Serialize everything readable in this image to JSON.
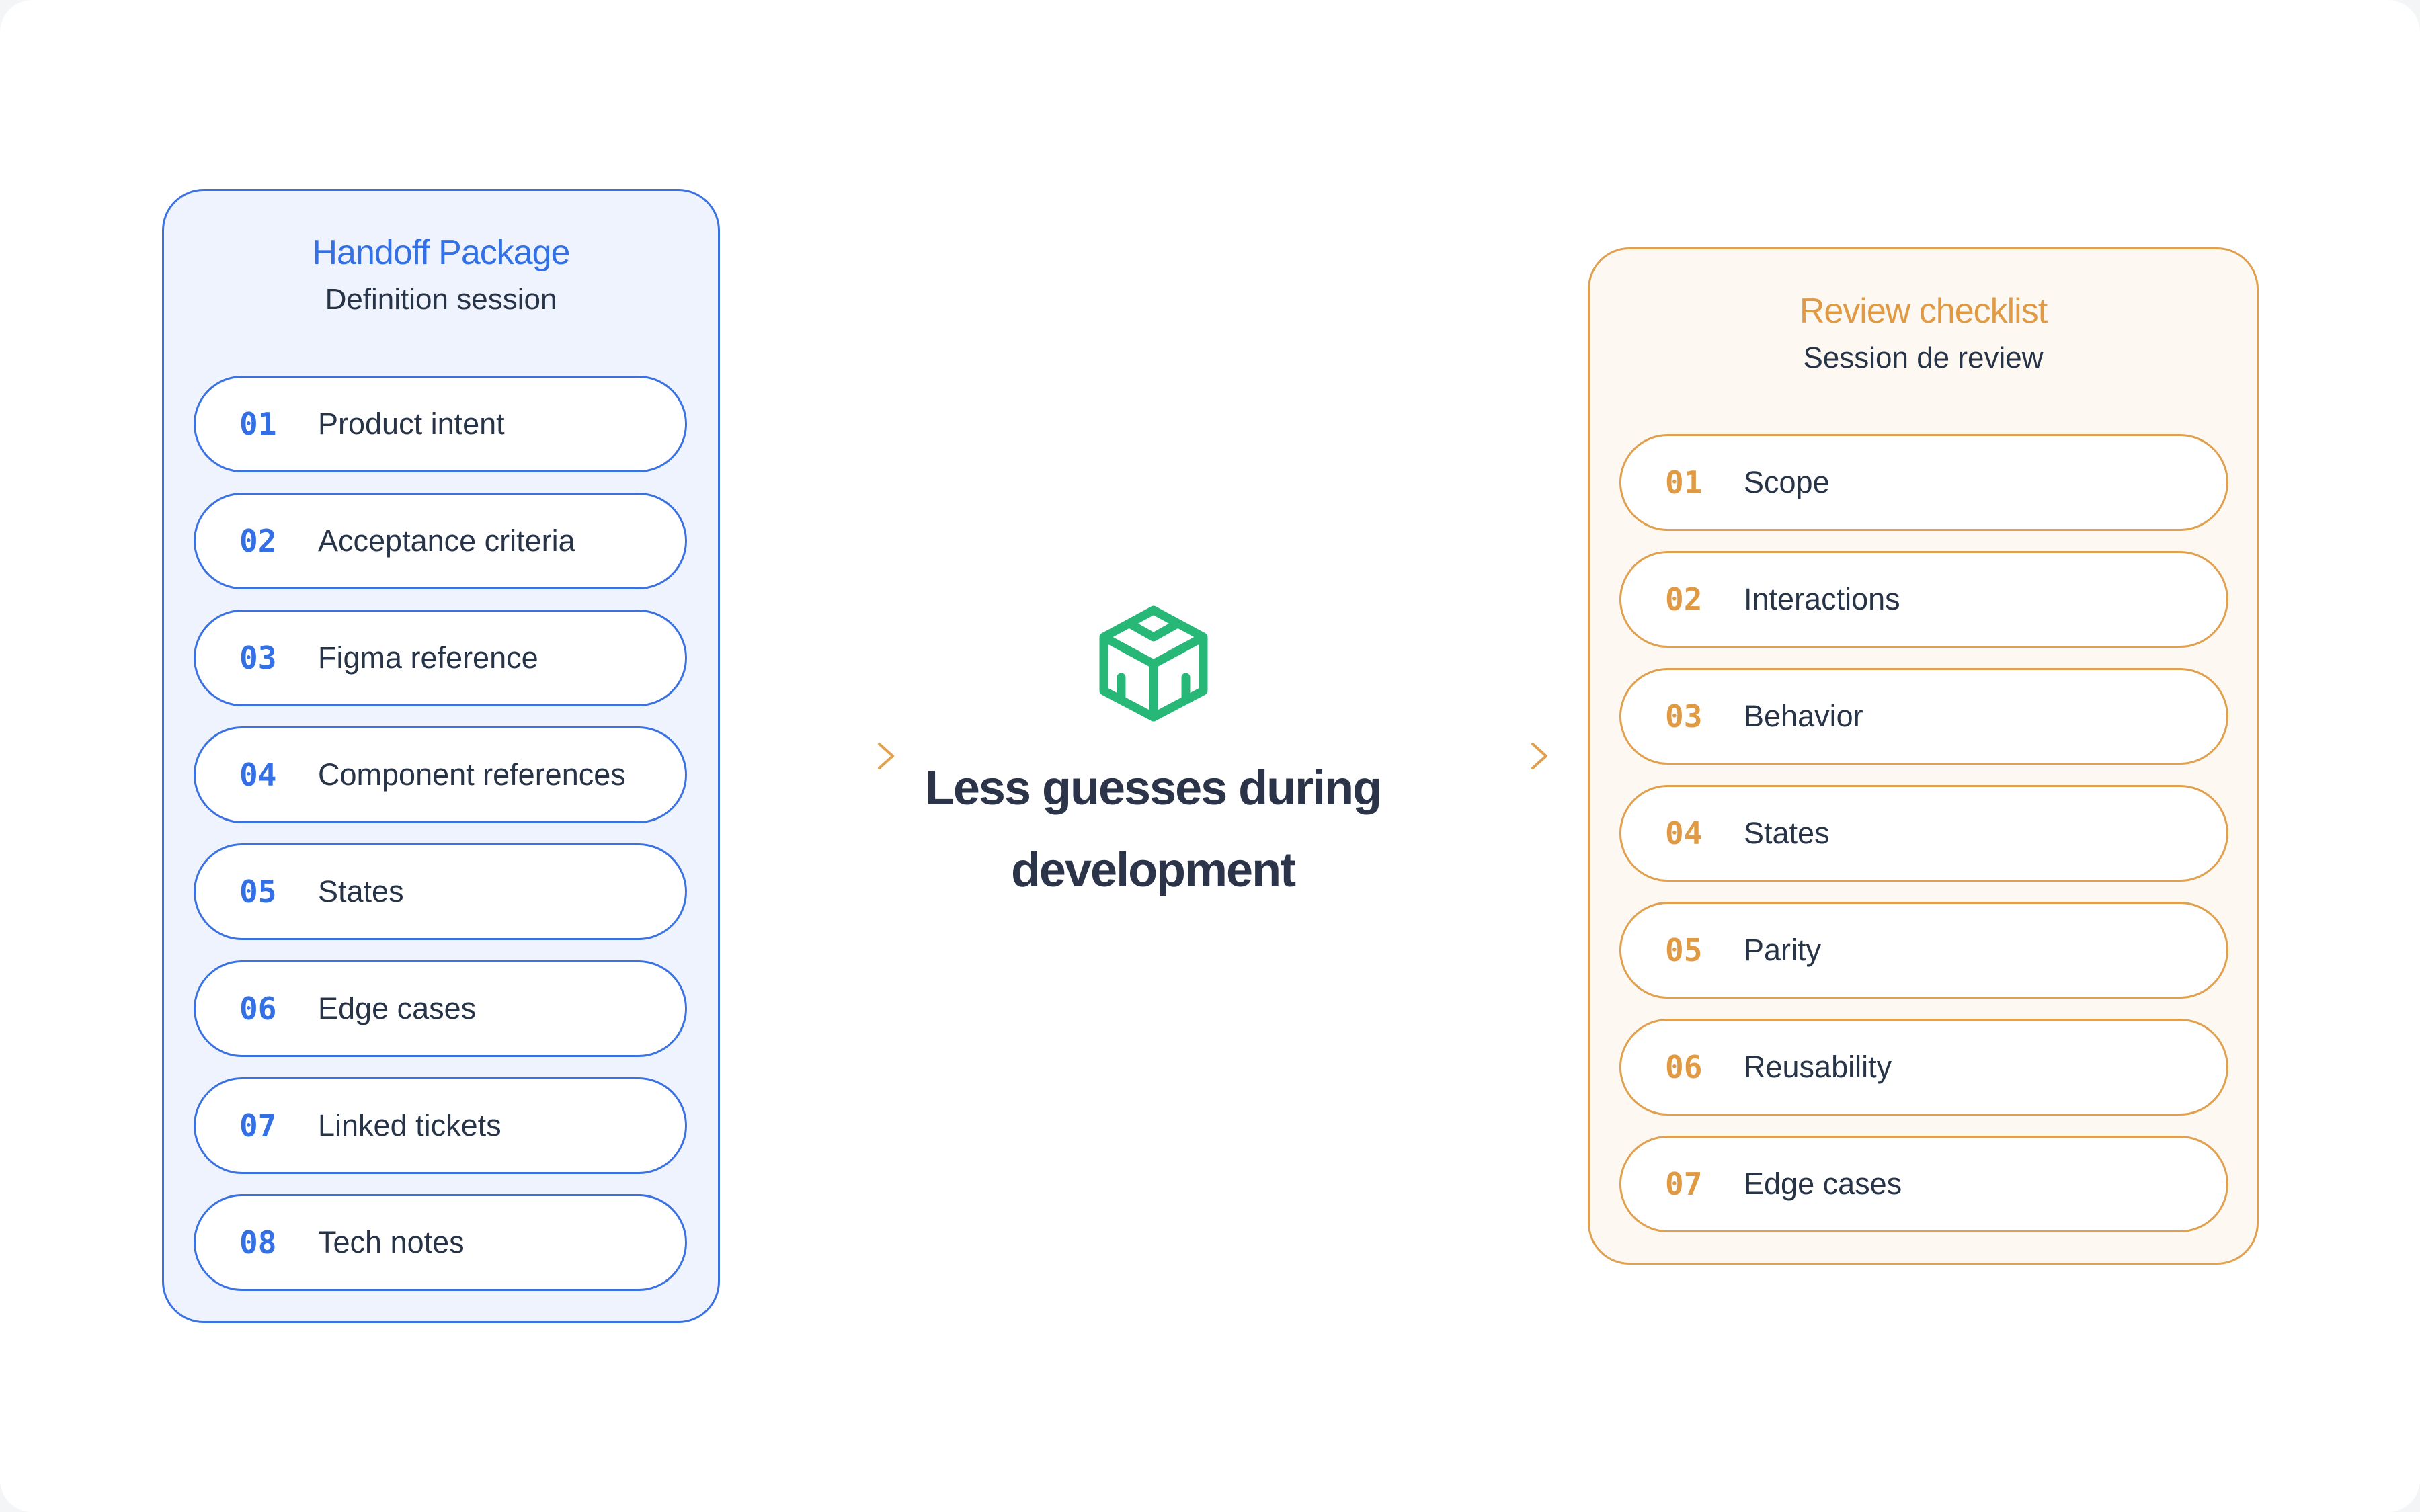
{
  "handoff": {
    "title": "Handoff Package",
    "subtitle": "Definition session",
    "items": [
      {
        "num": "01",
        "label": "Product intent"
      },
      {
        "num": "02",
        "label": "Acceptance criteria"
      },
      {
        "num": "03",
        "label": "Figma reference"
      },
      {
        "num": "04",
        "label": "Component references"
      },
      {
        "num": "05",
        "label": "States"
      },
      {
        "num": "06",
        "label": "Edge cases"
      },
      {
        "num": "07",
        "label": "Linked tickets"
      },
      {
        "num": "08",
        "label": "Tech notes"
      }
    ]
  },
  "center": {
    "icon": "cube-icon",
    "line1": "Less guesses during",
    "line2": "development"
  },
  "review": {
    "title": "Review checklist",
    "subtitle": "Session de review",
    "items": [
      {
        "num": "01",
        "label": "Scope"
      },
      {
        "num": "02",
        "label": "Interactions"
      },
      {
        "num": "03",
        "label": "Behavior"
      },
      {
        "num": "04",
        "label": "States"
      },
      {
        "num": "05",
        "label": "Parity"
      },
      {
        "num": "06",
        "label": "Reusability"
      },
      {
        "num": "07",
        "label": "Edge cases"
      }
    ]
  },
  "colors": {
    "blue_accent": "#3370e6",
    "orange_accent": "#e09a44",
    "green_icon": "#27b877",
    "text_dark": "#273347"
  }
}
